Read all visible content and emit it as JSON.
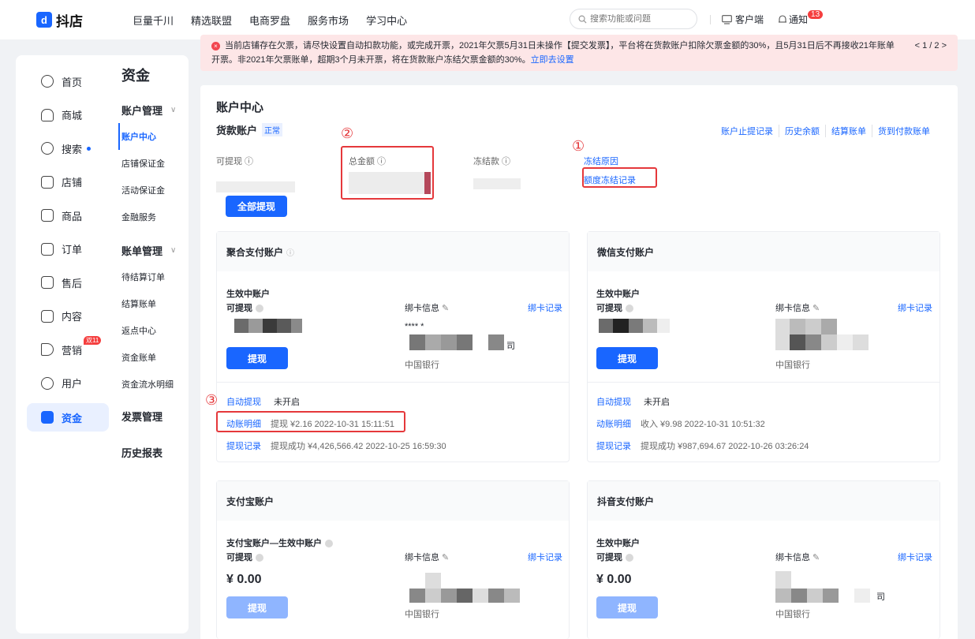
{
  "topbar": {
    "logo_text": "抖店",
    "nav": [
      "巨量千川",
      "精选联盟",
      "电商罗盘",
      "服务市场",
      "学习中心"
    ],
    "search_placeholder": "搜索功能或问题",
    "client_label": "客户端",
    "notify_label": "通知",
    "notify_count": "13"
  },
  "alert": {
    "text": "当前店铺存在欠票，请尽快设置自动扣款功能，或完成开票，2021年欠票5月31日未操作【提交发票】，平台将在货款账户扣除欠票金额的30%，且5月31日后不再接收21年账单开票。非2021年欠票账单，超期3个月未开票，将在货款账户冻结欠票金额的30%。",
    "link": "立即去设置",
    "pager": "< 1 / 2 >"
  },
  "sidebar": {
    "primary": [
      {
        "label": "首页",
        "icon": "home-icon"
      },
      {
        "label": "商城",
        "icon": "mall-icon"
      },
      {
        "label": "搜索",
        "icon": "search-chart-icon"
      },
      {
        "label": "店铺",
        "icon": "shop-icon"
      },
      {
        "label": "商品",
        "icon": "goods-icon"
      },
      {
        "label": "订单",
        "icon": "order-icon"
      },
      {
        "label": "售后",
        "icon": "aftersale-icon"
      },
      {
        "label": "内容",
        "icon": "content-icon"
      },
      {
        "label": "营销",
        "icon": "marketing-icon"
      },
      {
        "label": "用户",
        "icon": "user-icon"
      },
      {
        "label": "资金",
        "icon": "fund-icon"
      }
    ],
    "hot_badge": "双11",
    "section_title": "资金",
    "groups": {
      "account_mgmt": "账户管理",
      "account_items": [
        "账户中心",
        "店铺保证金",
        "活动保证金",
        "金融服务"
      ],
      "bill_mgmt": "账单管理",
      "bill_items": [
        "待结算订单",
        "结算账单",
        "返点中心",
        "资金账单",
        "资金流水明细"
      ],
      "invoice_mgmt": "发票管理",
      "history_report": "历史报表"
    }
  },
  "main": {
    "title": "账户中心",
    "account_name": "货款账户",
    "account_status": "正常",
    "top_links": [
      "账户止提记录",
      "历史余额",
      "结算账单",
      "货到付款账单"
    ],
    "metrics": {
      "withdrawable": "可提现",
      "total": "总金额",
      "frozen": "冻结款"
    },
    "freeze_reason": "冻结原因",
    "freeze_record": "额度冻结记录",
    "withdraw_all": "全部提现",
    "circles": [
      "①",
      "②",
      "③"
    ]
  },
  "cards": {
    "juhe": {
      "title": "聚合支付账户",
      "active_account": "生效中账户",
      "withdrawable": "可提现",
      "bind_info": "绑卡信息",
      "bind_record": "绑卡记录",
      "card_mask": "**** *",
      "bank_suffix": "司",
      "bank": "中国银行",
      "withdraw": "提现",
      "auto_withdraw": "自动提现",
      "auto_status": "未开启",
      "detail_label": "动账明细",
      "detail_value": "提现  ¥2.16  2022-10-31 15:11:51",
      "record_label": "提现记录",
      "record_value": "提现成功  ¥4,426,566.42  2022-10-25 16:59:30"
    },
    "wechat": {
      "title": "微信支付账户",
      "active_account": "生效中账户",
      "withdrawable": "可提现",
      "bind_info": "绑卡信息",
      "bind_record": "绑卡记录",
      "bank": "中国银行",
      "withdraw": "提现",
      "auto_withdraw": "自动提现",
      "auto_status": "未开启",
      "detail_label": "动账明细",
      "detail_value": "收入  ¥9.98  2022-10-31 10:51:32",
      "record_label": "提现记录",
      "record_value": "提现成功  ¥987,694.67  2022-10-26 03:26:24"
    },
    "alipay": {
      "title": "支付宝账户",
      "active_account": "支付宝账户—生效中账户",
      "withdrawable": "可提现",
      "amount": "¥ 0.00",
      "bind_info": "绑卡信息",
      "bind_record": "绑卡记录",
      "bank": "中国银行",
      "withdraw": "提现"
    },
    "douyin": {
      "title": "抖音支付账户",
      "active_account": "生效中账户",
      "withdrawable": "可提现",
      "amount": "¥ 0.00",
      "bind_info": "绑卡信息",
      "bind_record": "绑卡记录",
      "bank_suffix": "司",
      "bank": "中国银行",
      "withdraw": "提现"
    }
  }
}
